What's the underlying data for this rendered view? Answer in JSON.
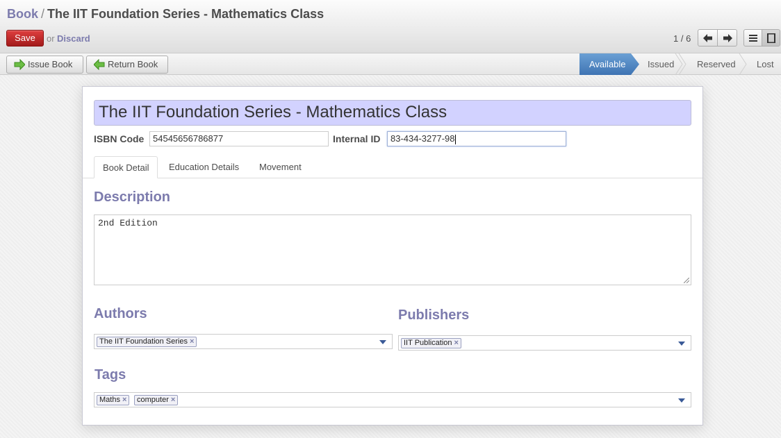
{
  "breadcrumb": {
    "parent": "Book",
    "separator": "/",
    "current": "The IIT Foundation Series - Mathematics Class"
  },
  "toolbar": {
    "save_label": "Save",
    "or_text": "or",
    "discard_label": "Discard",
    "pager_text": "1 / 6"
  },
  "actions": {
    "issue_label": "Issue Book",
    "return_label": "Return Book"
  },
  "stages": {
    "available": "Available",
    "issued": "Issued",
    "reserved": "Reserved",
    "lost": "Lost",
    "active": "Available",
    "active_color": "#4a81c0"
  },
  "form": {
    "title": "The IIT Foundation Series - Mathematics Class",
    "isbn_label": "ISBN Code",
    "isbn_value": "54545656786877",
    "internal_id_label": "Internal ID",
    "internal_id_value": "83-434-3277-98"
  },
  "tabs": [
    "Book Detail",
    "Education Details",
    "Movement"
  ],
  "description": {
    "title": "Description",
    "value": "2nd Edition"
  },
  "authors": {
    "title": "Authors",
    "tags": [
      "The IIT Foundation Series"
    ]
  },
  "publishers": {
    "title": "Publishers",
    "tags": [
      "IIT Publication"
    ]
  },
  "tags_section": {
    "title": "Tags",
    "tags": [
      "Maths",
      "computer"
    ]
  },
  "colors": {
    "accent": "#7c7bad",
    "save_button": "#c02a2a",
    "title_field_bg": "#d2d2ff"
  }
}
